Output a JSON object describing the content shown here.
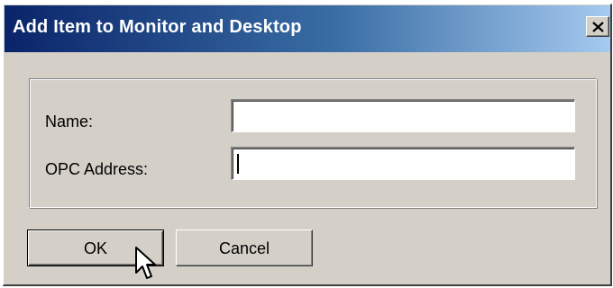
{
  "window": {
    "title": "Add Item to Monitor and Desktop",
    "close_glyph": "✕"
  },
  "form": {
    "name_label": "Name:",
    "name_value": "",
    "opc_label": "OPC Address:",
    "opc_value": ""
  },
  "buttons": {
    "ok_label": "OK",
    "cancel_label": "Cancel"
  },
  "colors": {
    "title_start": "#0a246a",
    "title_end": "#a6caf0",
    "face": "#d4d0c8"
  },
  "icons": {
    "close": "close-icon",
    "cursor": "mouse-pointer-icon"
  }
}
